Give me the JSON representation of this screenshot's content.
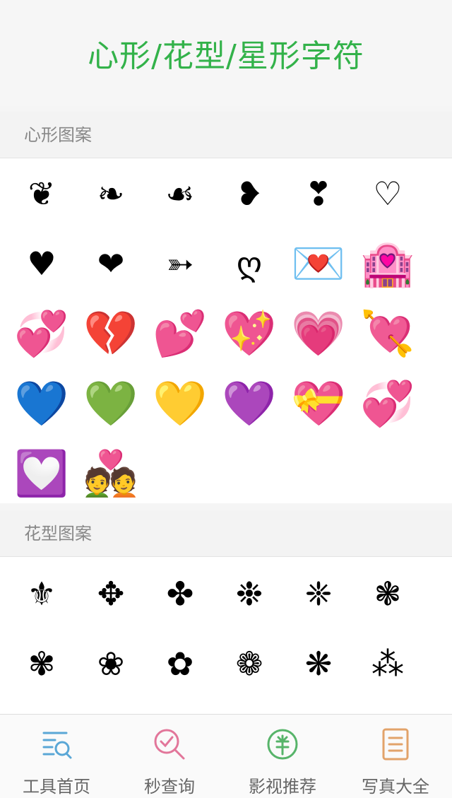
{
  "header": {
    "title": "心形/花型/星形字符"
  },
  "sections": {
    "hearts": {
      "title": "心形图案",
      "items": [
        "❦",
        "❧",
        "☙",
        "❥",
        "❣",
        "♡",
        "♥",
        "❤",
        "➳",
        "ღ",
        "💌",
        "🏩",
        "💞",
        "💔",
        "💕",
        "💖",
        "💗",
        "💘",
        "💙",
        "💚",
        "💛",
        "💜",
        "💝",
        "💞",
        "💟",
        "💑"
      ]
    },
    "flowers": {
      "title": "花型图案",
      "items": [
        "⚜",
        "✥",
        "✤",
        "❉",
        "❈",
        "❃",
        "✾",
        "❀",
        "✿",
        "❁",
        "❋",
        "⁂"
      ]
    }
  },
  "tabbar": {
    "tabs": [
      {
        "label": "工具首页",
        "icon": "tools-icon",
        "color": "#5aa7d6"
      },
      {
        "label": "秒查询",
        "icon": "search-icon",
        "color": "#e2769a"
      },
      {
        "label": "影视推荐",
        "icon": "film-icon",
        "color": "#57b46a"
      },
      {
        "label": "写真大全",
        "icon": "document-icon",
        "color": "#e2a36a"
      }
    ]
  }
}
